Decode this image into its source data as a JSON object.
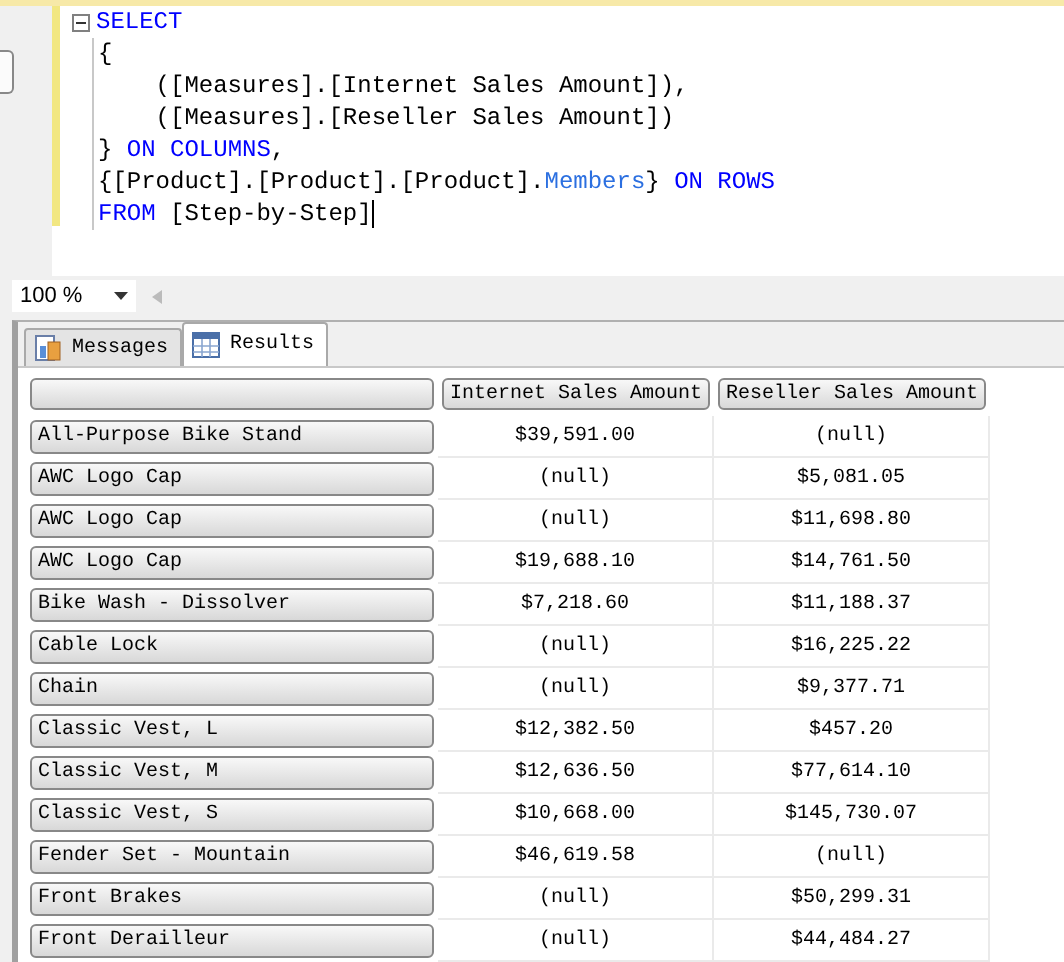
{
  "editor": {
    "lines": [
      {
        "collapsible": true,
        "tokens": [
          {
            "kind": "keyword",
            "text": "SELECT"
          }
        ]
      },
      {
        "collapsible": false,
        "tokens": [
          {
            "kind": "plain",
            "text": "{"
          }
        ]
      },
      {
        "collapsible": false,
        "tokens": [
          {
            "kind": "plain",
            "text": "    ([Measures].[Internet Sales Amount]),"
          }
        ]
      },
      {
        "collapsible": false,
        "tokens": [
          {
            "kind": "plain",
            "text": "    ([Measures].[Reseller Sales Amount])"
          }
        ]
      },
      {
        "collapsible": false,
        "tokens": [
          {
            "kind": "plain",
            "text": "} "
          },
          {
            "kind": "keyword",
            "text": "ON COLUMNS"
          },
          {
            "kind": "plain",
            "text": ","
          }
        ]
      },
      {
        "collapsible": false,
        "tokens": [
          {
            "kind": "plain",
            "text": "{[Product].[Product].[Product]."
          },
          {
            "kind": "function",
            "text": "Members"
          },
          {
            "kind": "plain",
            "text": "} "
          },
          {
            "kind": "keyword",
            "text": "ON ROWS"
          }
        ]
      },
      {
        "collapsible": false,
        "tokens": [
          {
            "kind": "keyword",
            "text": "FROM"
          },
          {
            "kind": "plain",
            "text": " [Step-by-Step]"
          }
        ]
      }
    ]
  },
  "zoom": {
    "value": "100 %"
  },
  "tabs": [
    {
      "label": "Messages",
      "selected": false
    },
    {
      "label": "Results",
      "selected": true
    }
  ],
  "table": {
    "columns": [
      "Internet Sales Amount",
      "Reseller Sales Amount"
    ],
    "rows": [
      {
        "label": "All-Purpose Bike Stand",
        "cells": [
          "$39,591.00",
          "(null)"
        ]
      },
      {
        "label": "AWC Logo Cap",
        "cells": [
          "(null)",
          "$5,081.05"
        ]
      },
      {
        "label": "AWC Logo Cap",
        "cells": [
          "(null)",
          "$11,698.80"
        ]
      },
      {
        "label": "AWC Logo Cap",
        "cells": [
          "$19,688.10",
          "$14,761.50"
        ]
      },
      {
        "label": "Bike Wash - Dissolver",
        "cells": [
          "$7,218.60",
          "$11,188.37"
        ]
      },
      {
        "label": "Cable Lock",
        "cells": [
          "(null)",
          "$16,225.22"
        ]
      },
      {
        "label": "Chain",
        "cells": [
          "(null)",
          "$9,377.71"
        ]
      },
      {
        "label": "Classic Vest, L",
        "cells": [
          "$12,382.50",
          "$457.20"
        ]
      },
      {
        "label": "Classic Vest, M",
        "cells": [
          "$12,636.50",
          "$77,614.10"
        ]
      },
      {
        "label": "Classic Vest, S",
        "cells": [
          "$10,668.00",
          "$145,730.07"
        ]
      },
      {
        "label": "Fender Set - Mountain",
        "cells": [
          "$46,619.58",
          "(null)"
        ]
      },
      {
        "label": "Front Brakes",
        "cells": [
          "(null)",
          "$50,299.31"
        ]
      },
      {
        "label": "Front Derailleur",
        "cells": [
          "(null)",
          "$44,484.27"
        ]
      }
    ]
  }
}
